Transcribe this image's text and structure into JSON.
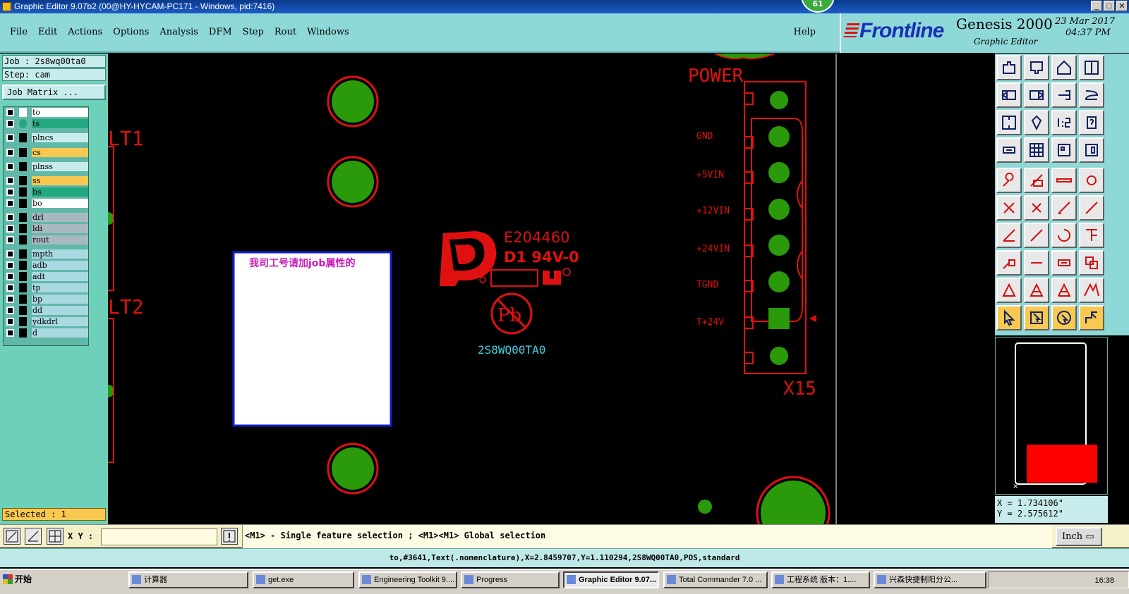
{
  "window": {
    "title": "Graphic Editor 9.07b2 (00@HY-HYCAM-PC171 - Windows, pid:7416)",
    "badge": "61"
  },
  "menu": [
    "File",
    "Edit",
    "Actions",
    "Options",
    "Analysis",
    "DFM",
    "Step",
    "Rout",
    "Windows"
  ],
  "help": "Help",
  "brand": {
    "logo": "Frontline",
    "product": "Genesis 2000",
    "subtitle": "Graphic Editor",
    "date": "23 Mar 2017",
    "time": "04:37 PM"
  },
  "job": {
    "job_line": "Job : 2s8wq00ta0",
    "step_line": "Step: cam",
    "matrix_button": "Job Matrix ..."
  },
  "layers": [
    {
      "name": "to",
      "color": "#ffffff"
    },
    {
      "name": "ts",
      "color": "#22a880"
    },
    {
      "name": "plncs",
      "color": "#c8ecec"
    },
    {
      "name": "cs",
      "color": "#f8c850"
    },
    {
      "name": "plnss",
      "color": "#c8ecec"
    },
    {
      "name": "ss",
      "color": "#f8c850"
    },
    {
      "name": "bs",
      "color": "#22a880"
    },
    {
      "name": "bo",
      "color": "#ffffff"
    },
    {
      "name": "drl",
      "color": "#a8b8c0"
    },
    {
      "name": "ldi",
      "color": "#a8b8c0"
    },
    {
      "name": "rout",
      "color": "#a8b8c0"
    },
    {
      "name": "mpth",
      "color": "#a8d8e0"
    },
    {
      "name": "adb",
      "color": "#a8d8e0"
    },
    {
      "name": "adt",
      "color": "#a8d8e0"
    },
    {
      "name": "tp",
      "color": "#a8d8e0"
    },
    {
      "name": "bp",
      "color": "#a8d8e0"
    },
    {
      "name": "dd",
      "color": "#a8d8e0"
    },
    {
      "name": "ydkdrl",
      "color": "#a8d8e0"
    },
    {
      "name": "d",
      "color": "#a8d8e0"
    }
  ],
  "selected": "Selected : 1",
  "canvas": {
    "label_power": "POWER",
    "label_lt1": "LT1",
    "label_lt2": "LT2",
    "label_x15": "X15",
    "pin_labels": [
      "GND",
      "+5VIN",
      "+12VIN",
      "+24VIN",
      "TGND",
      "T+24V"
    ],
    "ul_code": "E204460",
    "ul_rating": "D1  94V-0",
    "pb_mark": "Pb",
    "part_no": "2S8WQ00TA0",
    "note_text": "我司工号请加job属性的",
    "colors": {
      "copper": "#2a9a0a",
      "silk": "#e01010",
      "cyan_text": "#40d0e0"
    }
  },
  "coords": {
    "x": "X = 1.734106\"",
    "y": "Y = 2.575612\""
  },
  "command": {
    "xy_label": "X Y :",
    "xy_value": "",
    "hint": "<M1> - Single feature selection ; <M1><M1> Global selection",
    "unit": "Inch"
  },
  "status": "to,#3641,Text(.nomenclature),X=2.8459707,Y=1.110294,2S8WQ00TA0,POS,standard",
  "taskbar": {
    "start": "开始",
    "items": [
      "计算器",
      "get.exe",
      "Engineering Toolkit 9....",
      "Progress",
      "Graphic Editor 9.07...",
      "Total Commander 7.0 ...",
      "工程系统 版本：1....",
      "兴森快捷制阳分公..."
    ],
    "clock": "16:38"
  }
}
